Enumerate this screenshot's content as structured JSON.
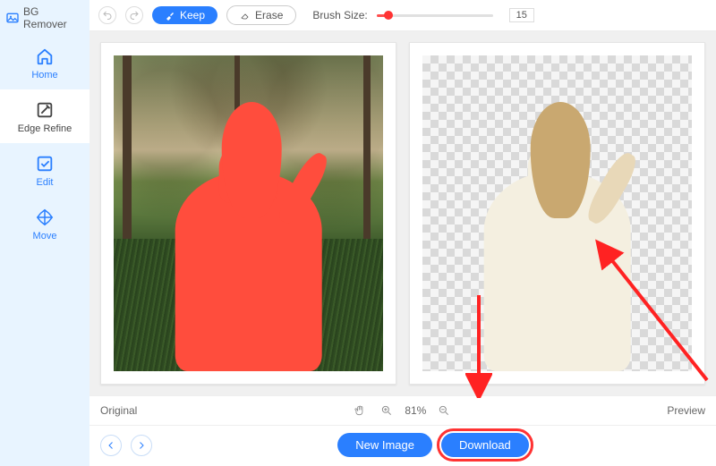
{
  "brand": "BG Remover",
  "sidebar": {
    "items": [
      {
        "label": "Home"
      },
      {
        "label": "Edge Refine"
      },
      {
        "label": "Edit"
      },
      {
        "label": "Move"
      }
    ]
  },
  "toolbar": {
    "keep": "Keep",
    "erase": "Erase",
    "brush_label": "Brush Size:",
    "brush_value": "15"
  },
  "status": {
    "original": "Original",
    "zoom": "81%",
    "preview": "Preview"
  },
  "bottom": {
    "new_image": "New Image",
    "download": "Download"
  }
}
